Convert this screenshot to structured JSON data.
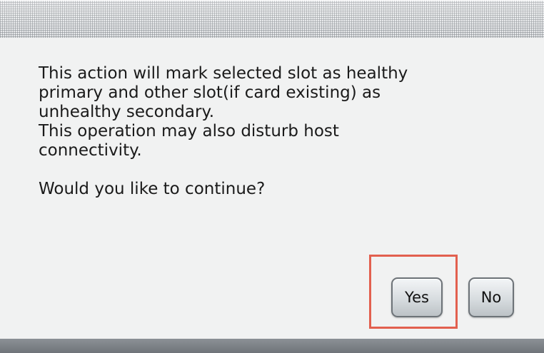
{
  "dialog": {
    "message_lines": [
      "This action will mark selected slot as healthy",
      "primary and other slot(if card existing) as",
      "unhealthy secondary.",
      "This operation may also disturb host",
      "connectivity."
    ],
    "question": "Would you like to continue?",
    "buttons": {
      "yes_label": "Yes",
      "no_label": "No"
    }
  },
  "colors": {
    "highlight": "#e2604f",
    "background": "#f1f2f2"
  }
}
